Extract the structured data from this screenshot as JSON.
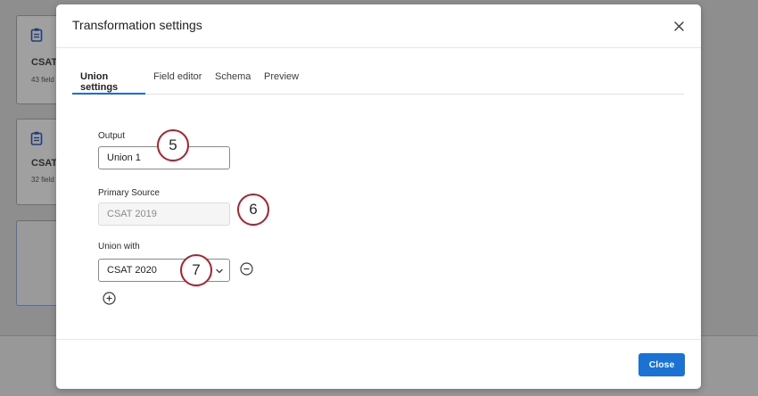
{
  "background": {
    "cards": [
      {
        "title": "CSAT",
        "subtitle": "43 field"
      },
      {
        "title": "CSAT",
        "subtitle": "32 field"
      }
    ]
  },
  "modal": {
    "title": "Transformation settings",
    "tabs": [
      {
        "label": "Union settings",
        "active": true
      },
      {
        "label": "Field editor",
        "active": false
      },
      {
        "label": "Schema",
        "active": false
      },
      {
        "label": "Preview",
        "active": false
      }
    ],
    "output": {
      "label": "Output",
      "value": "Union 1"
    },
    "primary_source": {
      "label": "Primary Source",
      "value": "CSAT 2019"
    },
    "union_with": {
      "label": "Union with",
      "selected": "CSAT 2020"
    },
    "callouts": [
      "5",
      "6",
      "7"
    ],
    "close_label": "Close"
  },
  "colors": {
    "accent": "#1b72d3",
    "callout_border": "#b0202c"
  }
}
